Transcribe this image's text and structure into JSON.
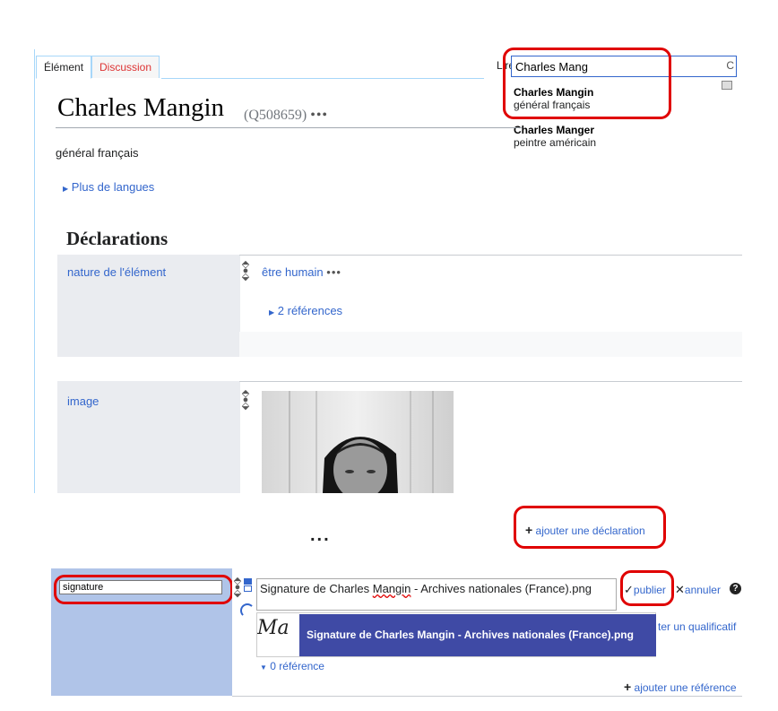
{
  "tabs": {
    "item": "Élément",
    "discussion": "Discussion",
    "read": "Lire"
  },
  "search": {
    "value": "Charles Mang",
    "go_glyph": "C",
    "suggestions": [
      {
        "title": "Charles Mangin",
        "description": "général français"
      },
      {
        "title": "Charles Manger",
        "description": "peintre américain"
      }
    ]
  },
  "entity": {
    "label": "Charles Mangin",
    "qid": "(Q508659)",
    "dots": "•••",
    "description": "général français",
    "more_languages": "Plus de langues"
  },
  "statements_heading": "Déclarations",
  "statements": [
    {
      "property": "nature de l'élément",
      "value": "être humain",
      "dots": "•••",
      "references": "2 références"
    },
    {
      "property": "image"
    }
  ],
  "ellipsis": "...",
  "add_statement": "ajouter une déclaration",
  "edit": {
    "property_value": "signature",
    "file_value_prefix": "Signature de Charles ",
    "file_value_misspelled": "Mangin",
    "file_value_suffix": " - Archives nationales (France).png",
    "file_suggestion": "Signature de Charles Mangin - Archives nationales (France).png",
    "thumb_text": "Ma",
    "publish": "publier",
    "cancel": "annuler",
    "help": "?",
    "add_qualifier": "ter un qualificatif",
    "references": "0 référence",
    "add_reference": "ajouter une référence"
  }
}
